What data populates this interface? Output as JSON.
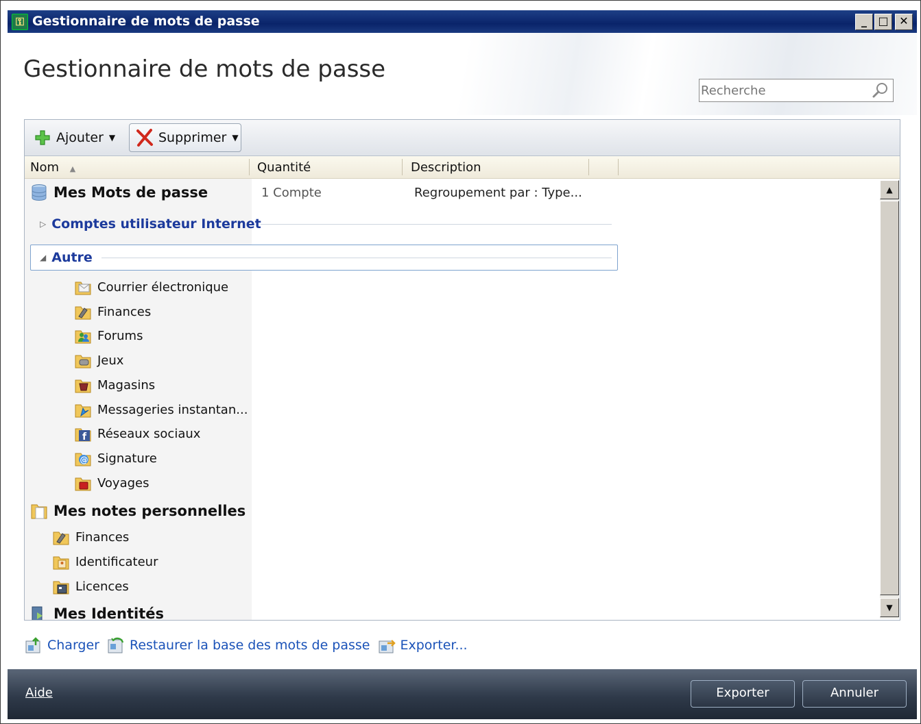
{
  "window": {
    "title": "Gestionnaire de mots de passe",
    "minimize": "_",
    "maximize": "□",
    "close": "✕"
  },
  "header": {
    "title": "Gestionnaire de mots de passe",
    "search_placeholder": "Recherche"
  },
  "toolbar": {
    "add_label": "Ajouter",
    "delete_label": "Supprimer"
  },
  "columns": {
    "name": "Nom",
    "quantity": "Quantité",
    "description": "Description"
  },
  "tree": {
    "passwords": {
      "label": "Mes Mots de passe",
      "quantity": "1 Compte",
      "description": "Regroupement par : Type..."
    },
    "group_internet": "Comptes utilisateur Internet",
    "group_other": "Autre",
    "other_items": [
      "Courrier électronique",
      "Finances",
      "Forums",
      "Jeux",
      "Magasins",
      "Messageries instantan...",
      "Réseaux sociaux",
      "Signature",
      "Voyages"
    ],
    "notes": {
      "label": "Mes notes personnelles",
      "items": [
        "Finances",
        "Identificateur",
        "Licences"
      ]
    },
    "identities": {
      "label": "Mes Identités"
    }
  },
  "links": {
    "load": "Charger",
    "restore": "Restaurer la base des mots de passe",
    "export": "Exporter..."
  },
  "footer": {
    "help": "Aide",
    "export_button": "Exporter",
    "cancel_button": "Annuler"
  }
}
